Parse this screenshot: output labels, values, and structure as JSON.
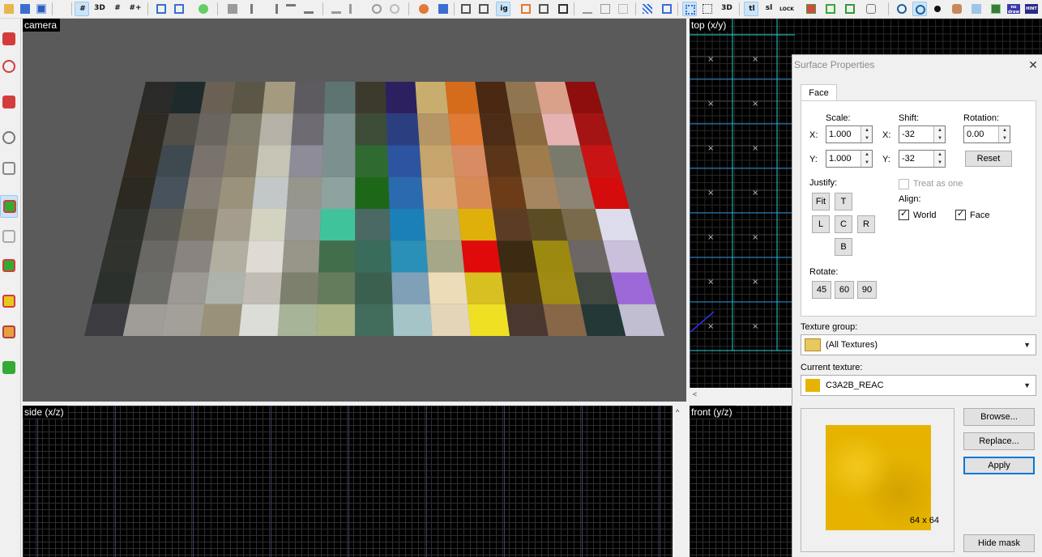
{
  "toolbar": {
    "buttons": [
      "open",
      "save",
      "save-as",
      "grid",
      "3d-grid",
      "grid-fine",
      "grid-larger",
      "group",
      "ungroup",
      "snap",
      "carve",
      "align-left",
      "align-right",
      "align-top",
      "align-bottom",
      "flip-h",
      "flip-v",
      "rotate",
      "texture-app",
      "texture-lock",
      "hide",
      "scale",
      "cut",
      "copy",
      "paste",
      "cordon",
      "cordon-toggle",
      "selection-tool",
      "select-mode",
      "3d-view",
      "tl",
      "sl",
      "lock",
      "entity",
      "camera-tool",
      "decal",
      "overlay",
      "clip",
      "magnify",
      "paint",
      "cover",
      "sky",
      "nodraw",
      "hint"
    ],
    "labels": {
      "three_d": "3D",
      "ig": "ig",
      "tl": "tl",
      "sl": "sl",
      "lock": "LOCK",
      "nodraw": "no draw",
      "hint": "HINT",
      "threed_b": "3D"
    }
  },
  "viewports": {
    "camera": "camera",
    "top": "top (x/y)",
    "side": "side (x/z)",
    "front": "front (y/z)"
  },
  "dialog": {
    "title": "Surface Properties",
    "tab": "Face",
    "scale_label": "Scale:",
    "shift_label": "Shift:",
    "rotation_label": "Rotation:",
    "x_label": "X:",
    "y_label": "Y:",
    "scale_x": "1.000",
    "scale_y": "1.000",
    "shift_x": "-32",
    "shift_y": "-32",
    "rotation": "0.00",
    "reset": "Reset",
    "justify_label": "Justify:",
    "justify": {
      "fit": "Fit",
      "t": "T",
      "l": "L",
      "c": "C",
      "r": "R",
      "b": "B"
    },
    "treat_as_one": "Treat as one",
    "align_label": "Align:",
    "align_world": "World",
    "align_face": "Face",
    "rotate_label": "Rotate:",
    "rotate": {
      "r45": "45",
      "r60": "60",
      "r90": "90"
    },
    "texture_group_label": "Texture group:",
    "texture_group": "(All Textures)",
    "current_texture_label": "Current texture:",
    "current_texture": "C3A2B_REAC",
    "browse": "Browse...",
    "replace": "Replace...",
    "apply": "Apply",
    "texture_size": "64 x 64",
    "hide_mask": "Hide mask",
    "checked": {
      "treat_as_one": false,
      "world": true,
      "face": true
    }
  },
  "texture_colors": [
    [
      "#2a2a28",
      "#1f2a2c",
      "#6a6154",
      "#5b5646",
      "#a39a80",
      "#5d5b60",
      "#5e7473",
      "#3c3a2c",
      "#2c2060",
      "#c9ad6e",
      "#d46c1c",
      "#4a2812",
      "#8f7650",
      "#d9a08a",
      "#8e0e0e"
    ],
    [
      "#2e2a22",
      "#524e48",
      "#6b6560",
      "#7f7c6c",
      "#b5b1a6",
      "#6e6c72",
      "#7c9090",
      "#3c4c36",
      "#2a3e80",
      "#b59566",
      "#e07a34",
      "#4c2c16",
      "#8a6a3e",
      "#e7b2b2",
      "#a41414"
    ],
    [
      "#302a20",
      "#3e4a50",
      "#7a726c",
      "#877f6c",
      "#c6c4b4",
      "#8e8c98",
      "#7c9090",
      "#2f6a30",
      "#2c54a0",
      "#c7a46c",
      "#d88c64",
      "#5c3418",
      "#a07c4c",
      "#7a7a6c",
      "#c81414"
    ],
    [
      "#2c2a20",
      "#48525c",
      "#847e74",
      "#9a927a",
      "#c2c8c8",
      "#96968c",
      "#8ea2a0",
      "#1c6818",
      "#2c6ab0",
      "#d3b07c",
      "#d88a54",
      "#6c3c18",
      "#a58660",
      "#8c8474",
      "#d40c0c"
    ],
    [
      "#2e302c",
      "#5c5a54",
      "#7a7464",
      "#a49c8c",
      "#d4d2c0",
      "#9a9a98",
      "#3fc39a",
      "#4a6864",
      "#1c80b8",
      "#b7b08c",
      "#dfb00a",
      "#5c3c24",
      "#5c4c24",
      "#7a6a4c",
      "#dcdcec"
    ],
    [
      "#30322e",
      "#6a6864",
      "#8a8480",
      "#b2aea0",
      "#e0dad4",
      "#989688",
      "#426e4c",
      "#3a6c5c",
      "#2a90b8",
      "#a6a688",
      "#e00a0a",
      "#3c2a12",
      "#9c8a10",
      "#6c6664",
      "#cac0dc"
    ],
    [
      "#2c302c",
      "#6c6c68",
      "#9c9894",
      "#aeb4ac",
      "#c0bcb4",
      "#7c806c",
      "#647c5c",
      "#3c6050",
      "#80a0b8",
      "#ecdcb8",
      "#d8c020",
      "#4c3814",
      "#a08c14",
      "#404840",
      "#9c68d8"
    ],
    [
      "#3c3c40",
      "#a09c98",
      "#a2a098",
      "#9a9278",
      "#dcdcd8",
      "#a8b498",
      "#aab484",
      "#426c5c",
      "#a4c4c8",
      "#e4d4b8",
      "#f0e024",
      "#4a3830",
      "#886648",
      "#243838",
      "#c0bed0"
    ]
  ]
}
